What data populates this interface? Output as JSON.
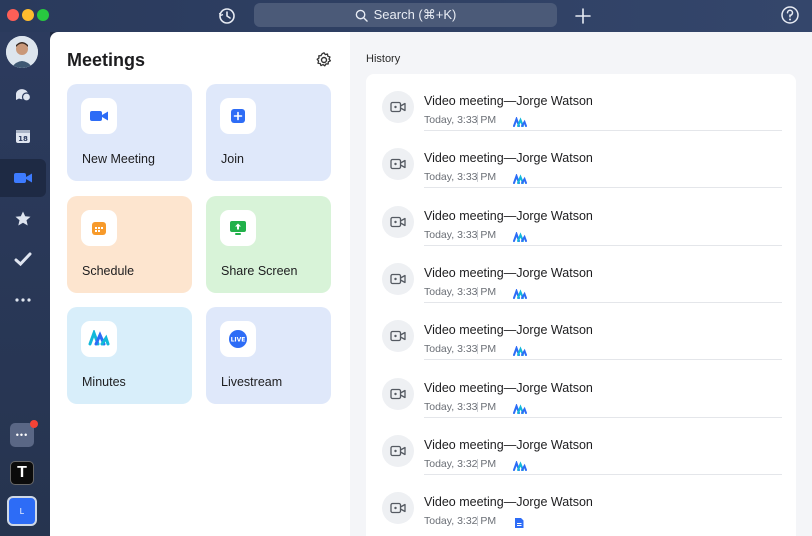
{
  "topbar": {
    "search_label": "Search (⌘+K)",
    "colors": {
      "close": "#fe5f57",
      "minimize": "#febc2e",
      "zoom": "#28c840"
    }
  },
  "sidebar": {
    "items": [
      "chat-icon",
      "calendar-icon",
      "meetings-icon",
      "star-icon",
      "check-icon",
      "more-icon"
    ],
    "calendar_day": "18",
    "apps_more_label": "•••",
    "workspace_t_label": "T",
    "workspace_l_label": "L"
  },
  "meetings": {
    "title": "Meetings",
    "tiles": [
      {
        "label": "New Meeting",
        "icon": "video-camera-icon"
      },
      {
        "label": "Join",
        "icon": "plus-icon"
      },
      {
        "label": "Schedule",
        "icon": "calendar-icon"
      },
      {
        "label": "Share Screen",
        "icon": "share-screen-icon"
      },
      {
        "label": "Minutes",
        "icon": "minutes-icon"
      },
      {
        "label": "Livestream",
        "icon": "live-icon",
        "badge": "LIVE"
      }
    ]
  },
  "history": {
    "label": "History",
    "rows": [
      {
        "title": "Video meeting—Jorge Watson",
        "time": "Today, 3:33 PM",
        "attachment": "minutes"
      },
      {
        "title": "Video meeting—Jorge Watson",
        "time": "Today, 3:33 PM",
        "attachment": "minutes"
      },
      {
        "title": "Video meeting—Jorge Watson",
        "time": "Today, 3:33 PM",
        "attachment": "minutes"
      },
      {
        "title": "Video meeting—Jorge Watson",
        "time": "Today, 3:33 PM",
        "attachment": "minutes"
      },
      {
        "title": "Video meeting—Jorge Watson",
        "time": "Today, 3:33 PM",
        "attachment": "minutes"
      },
      {
        "title": "Video meeting—Jorge Watson",
        "time": "Today, 3:33 PM",
        "attachment": "minutes"
      },
      {
        "title": "Video meeting—Jorge Watson",
        "time": "Today, 3:32 PM",
        "attachment": "minutes"
      },
      {
        "title": "Video meeting—Jorge Watson",
        "time": "Today, 3:32 PM",
        "attachment": "doc"
      }
    ]
  },
  "colors": {
    "accent": "#2d6cf6",
    "sidebar": "#2c3b5e"
  }
}
